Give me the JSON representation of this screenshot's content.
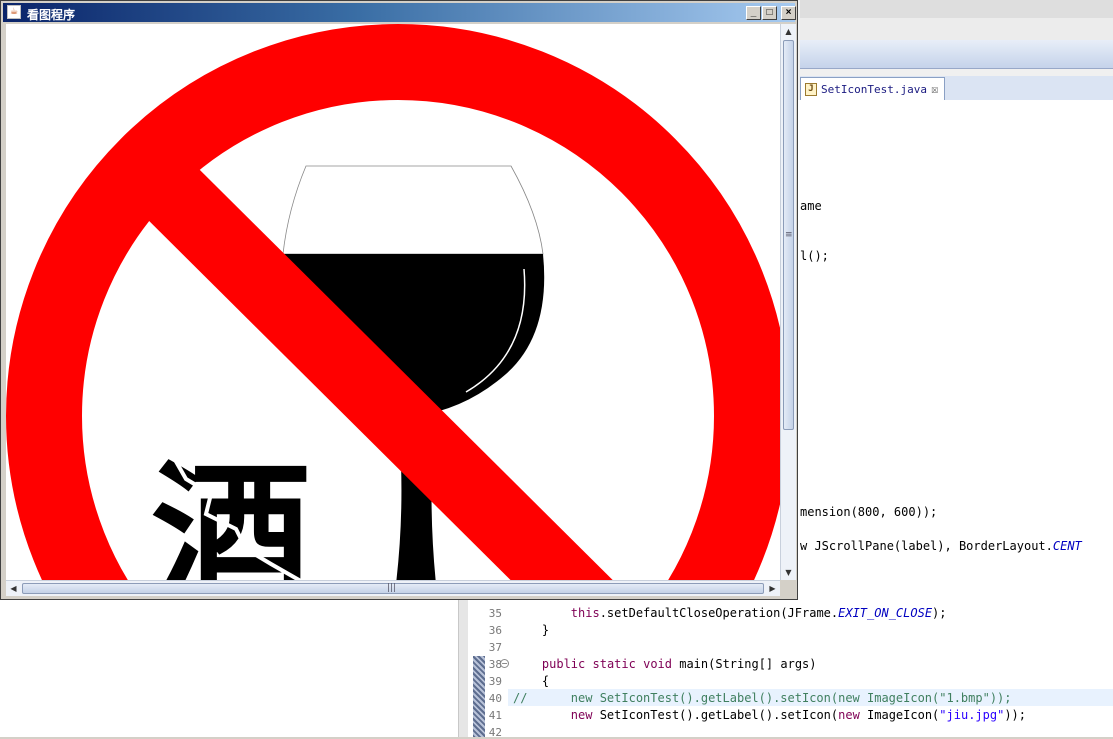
{
  "window": {
    "title": "看图程序",
    "app_icon": "java-coffee-icon",
    "controls": {
      "minimize": "_",
      "maximize": "□",
      "close": "×"
    }
  },
  "image": {
    "sign_text": "酒",
    "colors": {
      "red": "#ff0000",
      "black": "#000000",
      "white": "#ffffff"
    }
  },
  "ide": {
    "tab": {
      "label": "SetIconTest.java",
      "icon": "J"
    },
    "code_fragments": [
      "ame",
      "l();",
      "mension(800, 600));",
      "w JScrollPane(label), BorderLayout.CENT"
    ],
    "lines": [
      {
        "num": "35",
        "text": "        this.setDefaultCloseOperation(JFrame.EXIT_ON_CLOSE);"
      },
      {
        "num": "36",
        "text": "    }"
      },
      {
        "num": "37",
        "text": ""
      },
      {
        "num": "38",
        "text": "    public static void main(String[] args)"
      },
      {
        "num": "39",
        "text": "    {"
      },
      {
        "num": "40",
        "text": "//      new SetIconTest().getLabel().setIcon(new ImageIcon(\"1.bmp\"));"
      },
      {
        "num": "41",
        "text": "        new SetIconTest().getLabel().setIcon(new ImageIcon(\"jiu.jpg\"));"
      },
      {
        "num": "42",
        "text": ""
      }
    ]
  }
}
